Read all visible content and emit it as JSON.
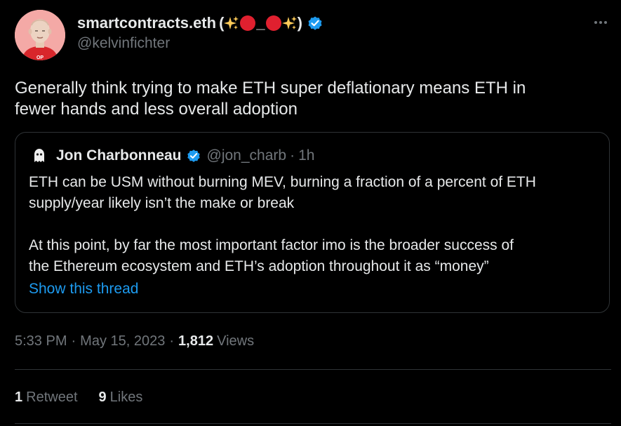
{
  "tweet": {
    "author": {
      "display_name": "smartcontracts.eth",
      "emoji_open": "(",
      "emoji_underscore": "_",
      "emoji_close": ")",
      "handle": "@kelvinfichter",
      "avatar_badge_text": "OP",
      "avatar_icon": "avatar-icon",
      "verified_icon": "verified-badge-icon",
      "verified_color": "#1d9bf0"
    },
    "more_icon": "more-options-icon",
    "text_line_1": "Generally think trying to make ETH super deflationary means ETH in",
    "text_line_2": "fewer hands and less overall adoption",
    "quote": {
      "display_name": "Jon Charbonneau",
      "handle": "@jon_charb",
      "separator": "·",
      "time": "1h",
      "paragraph_1_line_1": "ETH can be USM without burning MEV, burning a fraction of a percent of ETH",
      "paragraph_1_line_2": "supply/year likely isn’t the make or break",
      "paragraph_2_line_1": "At this point, by far the most important factor imo is the broader success of",
      "paragraph_2_line_2": "the Ethereum ecosystem and ETH’s adoption throughout it as “money”",
      "show_thread": "Show this thread"
    },
    "meta": {
      "time": "5:33 PM",
      "separator": "·",
      "date": "May 15, 2023",
      "views_count": "1,812",
      "views_label": "Views"
    },
    "stats": {
      "retweets_count": "1",
      "retweets_label": "Retweet",
      "likes_count": "9",
      "likes_label": "Likes"
    }
  },
  "colors": {
    "background": "#000000",
    "text": "#e7e9ea",
    "muted": "#71767b",
    "accent": "#1d9bf0",
    "border": "#2f3336"
  }
}
